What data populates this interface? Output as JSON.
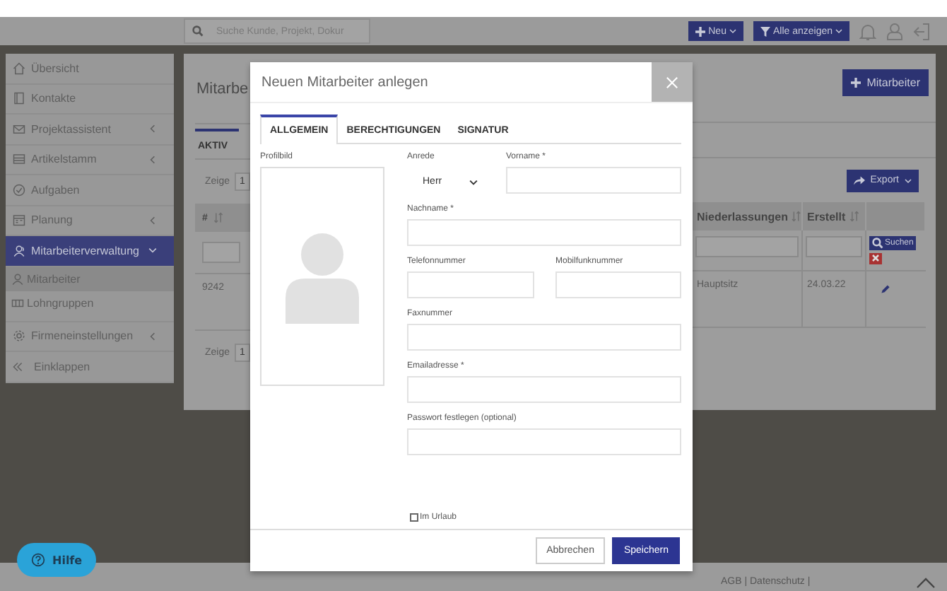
{
  "topbar": {
    "search": {
      "placeholder": "Suche Kunde, Projekt, Dokur"
    },
    "buttons": [
      "Neu",
      "Alle anzeigen"
    ]
  },
  "sidebar": {
    "items": [
      {
        "label": "Übersicht",
        "selected": false
      },
      {
        "label": "Kontakte",
        "selected": false
      },
      {
        "label": "Projektassistent",
        "selected": false,
        "expanded": false
      },
      {
        "label": "Artikelstamm",
        "selected": false,
        "expanded": false
      },
      {
        "label": "Aufgaben",
        "selected": false
      },
      {
        "label": "Planung",
        "selected": false,
        "expanded": false
      },
      {
        "label": "Mitarbeiterverwaltung",
        "selected": true,
        "expanded": true,
        "children": [
          {
            "label": "Mitarbeiter",
            "selected": true
          },
          {
            "label": "Lohngruppen",
            "selected": false
          }
        ]
      },
      {
        "label": "Firmeneinstellungen",
        "selected": false,
        "expanded": false
      }
    ],
    "collapse": "Einklappen"
  },
  "page": {
    "title": "Mitarbe",
    "add_button": "Mitarbeiter",
    "tabs": [
      {
        "label": "AKTIV",
        "selected": true
      }
    ],
    "top_length": {
      "label": "Zeige",
      "value": "1"
    },
    "export_button": "Export",
    "table": {
      "columns": [
        "#",
        "Niederlassungen",
        "Erstellt"
      ],
      "search_button": "Suchen",
      "rows": [
        [
          "9242",
          "Hauptsitz",
          "24.03.22"
        ]
      ]
    },
    "bottom_length": {
      "label": "Zeige",
      "value": "1"
    }
  },
  "modal": {
    "title": "Neuen Mitarbeiter anlegen",
    "tabs": [
      {
        "label": "ALLGEMEIN",
        "selected": true
      },
      {
        "label": "BERECHTIGUNGEN",
        "selected": false
      },
      {
        "label": "SIGNATUR",
        "selected": false
      }
    ],
    "profile_label": "Profilbild",
    "rows": [
      [
        {
          "kind": "select",
          "label": "Anrede",
          "value": "Herr"
        },
        {
          "kind": "text",
          "label": "Vorname *"
        }
      ],
      [
        {
          "kind": "text",
          "label": "Nachname *"
        }
      ],
      [
        {
          "kind": "text",
          "label": "Telefonnummer"
        },
        {
          "kind": "text",
          "label": "Mobilfunknummer"
        }
      ],
      [
        {
          "kind": "text",
          "label": "Faxnummer"
        }
      ],
      [
        {
          "kind": "text",
          "label": "Emailadresse *"
        }
      ],
      [
        {
          "kind": "text",
          "label": "Passwort festlegen (optional)"
        }
      ],
      [
        {
          "kind": "checkbox",
          "label": "Im Urlaub",
          "checked": false
        }
      ]
    ],
    "buttons": [
      "Abbrechen",
      "Speichern"
    ]
  },
  "footer": {
    "links": "AGB | Datenschutz |"
  },
  "help_button": "Hilfe"
}
